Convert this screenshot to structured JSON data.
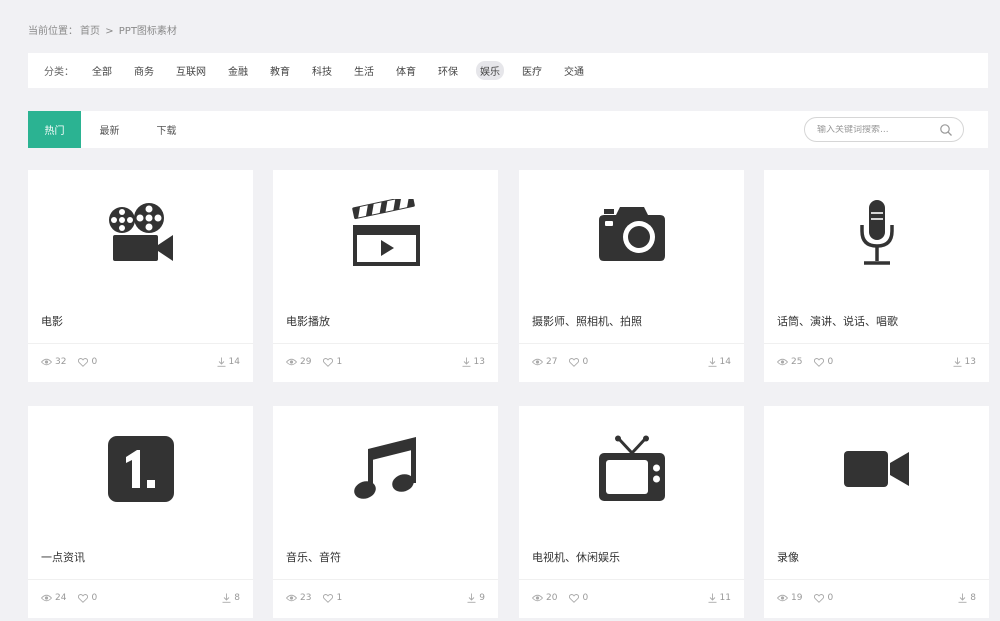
{
  "breadcrumb": {
    "prefix": "当前位置：",
    "home": "首页",
    "sep": ">",
    "current": "PPT图标素材"
  },
  "filters": {
    "label": "分类：",
    "items": [
      "全部",
      "商务",
      "互联网",
      "金融",
      "教育",
      "科技",
      "生活",
      "体育",
      "环保",
      "娱乐",
      "医疗",
      "交通"
    ],
    "active": "娱乐"
  },
  "tabs": [
    "热门",
    "最新",
    "下载"
  ],
  "search": {
    "placeholder": "输入关键词搜索..."
  },
  "accent_color": "#2bb392",
  "cards": [
    {
      "title": "电影",
      "icon": "film-projector-icon",
      "views": "32",
      "likes": "0",
      "downloads": "14"
    },
    {
      "title": "电影播放",
      "icon": "clapperboard-icon",
      "views": "29",
      "likes": "1",
      "downloads": "13"
    },
    {
      "title": "摄影师、照相机、拍照",
      "icon": "camera-icon",
      "views": "27",
      "likes": "0",
      "downloads": "14"
    },
    {
      "title": "话筒、演讲、说话、唱歌",
      "icon": "microphone-icon",
      "views": "25",
      "likes": "0",
      "downloads": "13"
    },
    {
      "title": "一点资讯",
      "icon": "yidian-app-icon",
      "views": "24",
      "likes": "0",
      "downloads": "8"
    },
    {
      "title": "音乐、音符",
      "icon": "music-note-icon",
      "views": "23",
      "likes": "1",
      "downloads": "9"
    },
    {
      "title": "电视机、休闲娱乐",
      "icon": "tv-icon",
      "views": "20",
      "likes": "0",
      "downloads": "11"
    },
    {
      "title": "录像",
      "icon": "video-camera-icon",
      "views": "19",
      "likes": "0",
      "downloads": "8"
    }
  ]
}
